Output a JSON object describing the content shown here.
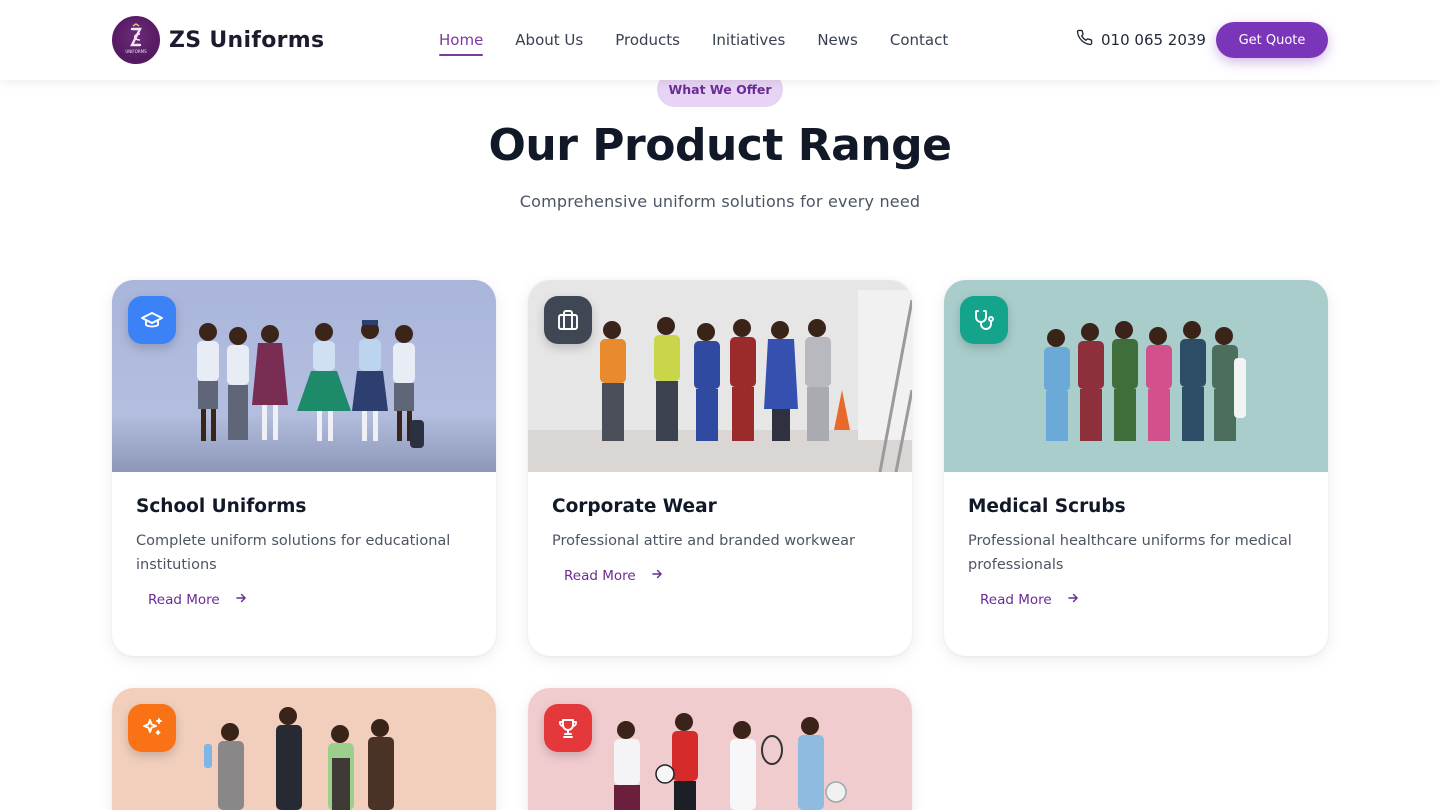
{
  "header": {
    "brand": "ZS Uniforms",
    "logo_text": "UNIFORMS",
    "nav": [
      {
        "label": "Home",
        "active": true
      },
      {
        "label": "About Us"
      },
      {
        "label": "Products"
      },
      {
        "label": "Initiatives"
      },
      {
        "label": "News"
      },
      {
        "label": "Contact"
      }
    ],
    "phone": "010 065 2039",
    "cta": "Get Quote"
  },
  "section": {
    "eyebrow": "What We Offer",
    "title": "Our Product Range",
    "subtitle": "Comprehensive uniform solutions for every need"
  },
  "cards": [
    {
      "title": "School Uniforms",
      "description": "Complete uniform solutions for educational institutions",
      "link": "Read More",
      "icon": "graduation-cap-icon",
      "icon_color": "#3b82f6"
    },
    {
      "title": "Corporate Wear",
      "description": "Professional attire and branded workwear",
      "link": "Read More",
      "icon": "briefcase-icon",
      "icon_color": "#3f4654"
    },
    {
      "title": "Medical Scrubs",
      "description": "Professional healthcare uniforms for medical professionals",
      "link": "Read More",
      "icon": "stethoscope-icon",
      "icon_color": "#14a38b"
    },
    {
      "icon": "sparkles-icon",
      "icon_color": "#f97316"
    },
    {
      "icon": "trophy-icon",
      "icon_color": "#e5383b"
    }
  ],
  "colors": {
    "accent": "#7a35b8",
    "accent_text": "#6b2c94",
    "eyebrow_bg": "#e7d3f3"
  }
}
